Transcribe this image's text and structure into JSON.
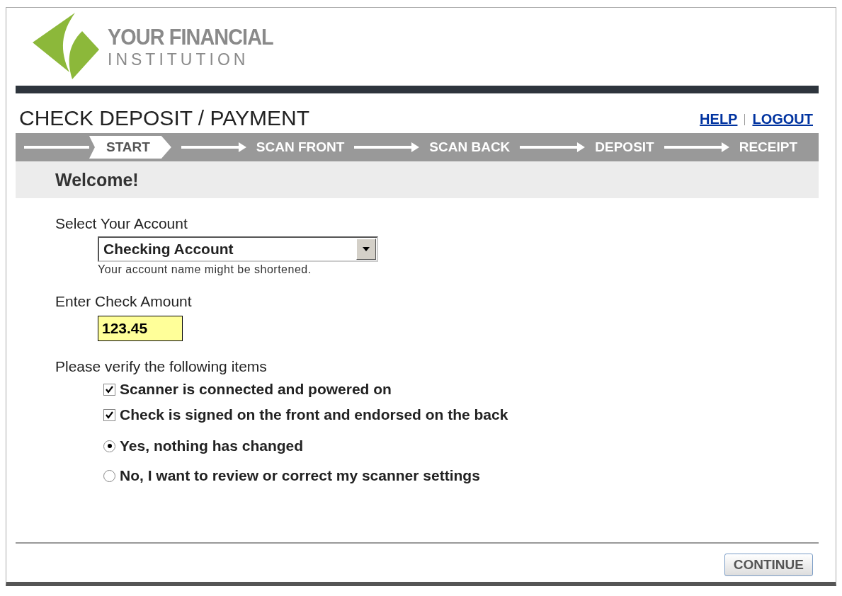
{
  "logo": {
    "line_1": "YOUR FINANCIAL",
    "line_2": "INSTITUTION"
  },
  "title": "CHECK DEPOSIT / PAYMENT",
  "links": [
    "HELP",
    "LOGOUT"
  ],
  "steps": [
    {
      "label": "START",
      "selected": true
    },
    {
      "label": "SCAN FRONT",
      "selected": false
    },
    {
      "label": "SCAN BACK",
      "selected": false
    },
    {
      "label": "DEPOSIT",
      "selected": false
    },
    {
      "label": "RECEIPT",
      "selected": false
    }
  ],
  "section_title": "Welcome!",
  "account": {
    "label": "Select Your Account",
    "value": "Checking Account",
    "hint": "Your account name might be shortened."
  },
  "amount": {
    "label": "Enter Check Amount",
    "value": "123.45"
  },
  "verify_label": "Please verify the following items",
  "checks": [
    {
      "label": "Scanner is connected and powered on",
      "checked": true
    },
    {
      "label": "Check is signed on the front and endorsed on the back",
      "checked": true
    }
  ],
  "options": [
    {
      "label": "Yes, nothing has changed",
      "selected": true
    },
    {
      "label": "No, I want to review or correct my scanner settings",
      "selected": false
    }
  ],
  "continue_button": "CONTINUE"
}
